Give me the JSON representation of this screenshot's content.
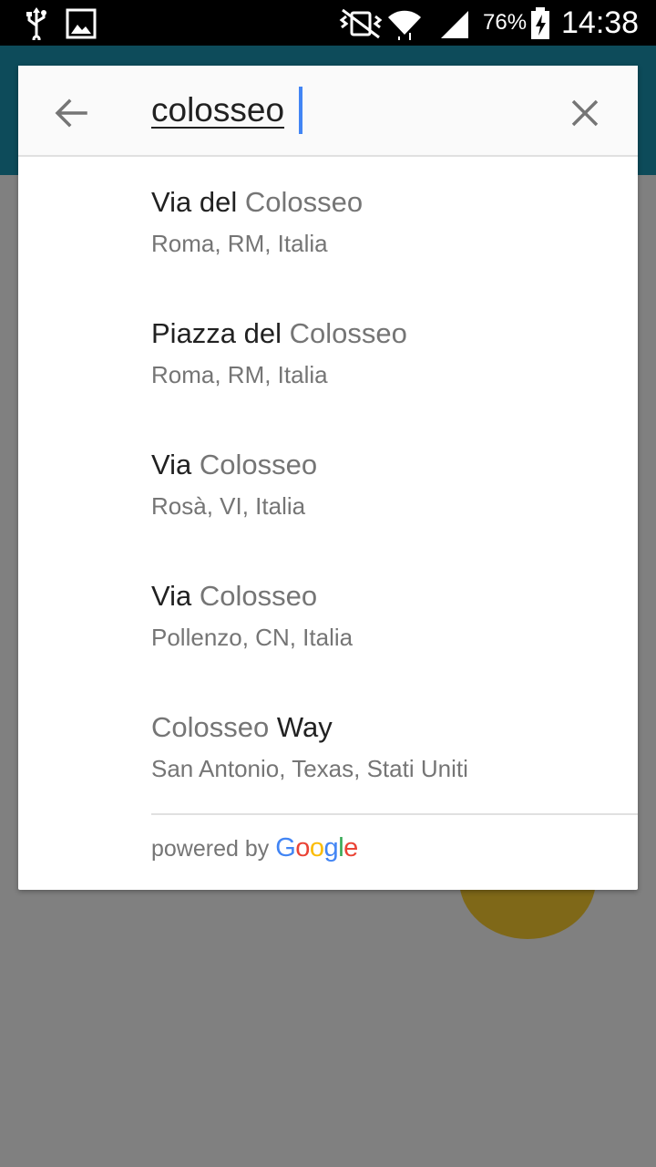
{
  "status_bar": {
    "icons_left": [
      "usb-icon",
      "image-icon"
    ],
    "icons_right": [
      "mute-vibrate-icon",
      "wifi-icon",
      "signal-icon",
      "battery-charging-icon"
    ],
    "battery_percent": "76%",
    "time": "14:38"
  },
  "search": {
    "query": "colosseo",
    "back_icon": "arrow-back-icon",
    "clear_icon": "close-icon"
  },
  "results": [
    {
      "pre": "Via del ",
      "match": "Colosseo",
      "post": "",
      "secondary": "Roma, RM, Italia"
    },
    {
      "pre": "Piazza del ",
      "match": "Colosseo",
      "post": "",
      "secondary": "Roma, RM, Italia"
    },
    {
      "pre": "Via ",
      "match": "Colosseo",
      "post": "",
      "secondary": "Rosà, VI, Italia"
    },
    {
      "pre": "Via ",
      "match": "Colosseo",
      "post": "",
      "secondary": "Pollenzo, CN, Italia"
    },
    {
      "pre": "",
      "match": "Colosseo",
      "post": " Way",
      "secondary": "San Antonio, Texas, Stati Uniti"
    }
  ],
  "footer": {
    "powered_by": "powered by",
    "brand": "Google"
  },
  "colors": {
    "accent": "#4285f4",
    "appbar": "#0d4b5a",
    "google": [
      "#4285F4",
      "#EA4335",
      "#FBBC05",
      "#4285F4",
      "#34A853",
      "#EA4335"
    ]
  }
}
